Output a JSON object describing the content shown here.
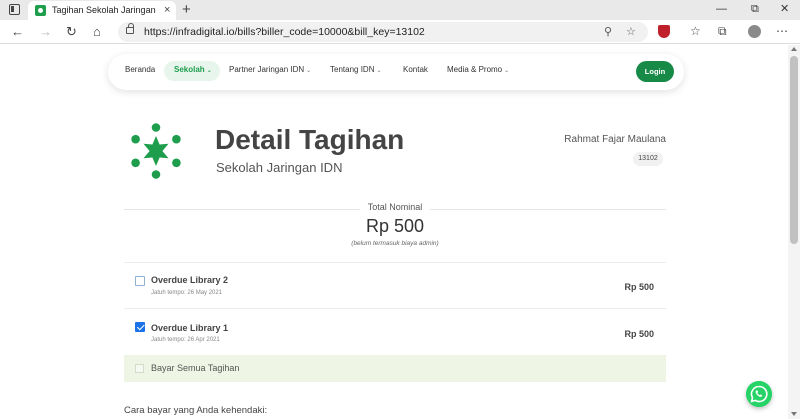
{
  "browser": {
    "tab_title": "Tagihan Sekolah Jaringan IDN",
    "close_glyph": "×",
    "new_tab_glyph": "+",
    "url": "https://infradigital.io/bills?biller_code=10000&bill_key=13102"
  },
  "nav": {
    "items": [
      {
        "label": "Beranda"
      },
      {
        "label": "Sekolah",
        "caret": "⌄"
      },
      {
        "label": "Partner Jaringan IDN",
        "caret": "⌄"
      },
      {
        "label": "Tentang IDN",
        "caret": "⌄"
      },
      {
        "label": "Kontak"
      },
      {
        "label": "Media & Promo",
        "caret": "⌄"
      }
    ],
    "login_label": "Login",
    "accent_color": "#1e9e4c"
  },
  "bill": {
    "title": "Detail Tagihan",
    "subtitle": "Sekolah Jaringan IDN",
    "customer_name": "Rahmat Fajar Maulana",
    "customer_key": "13102",
    "total_label": "Total Nominal",
    "total_amount": "Rp 500",
    "total_note": "(belum termasuk biaya admin)",
    "items": [
      {
        "name": "Overdue Library 2",
        "due": "Jatuh tempo: 26 May 2021",
        "amount": "Rp 500",
        "checked": false
      },
      {
        "name": "Overdue Library 1",
        "due": "Jatuh tempo: 26 Apr 2021",
        "amount": "Rp 500",
        "checked": true
      }
    ],
    "pay_all_label": "Bayar Semua Tagihan",
    "payment_prompt": "Cara bayar yang Anda kehendaki:"
  }
}
